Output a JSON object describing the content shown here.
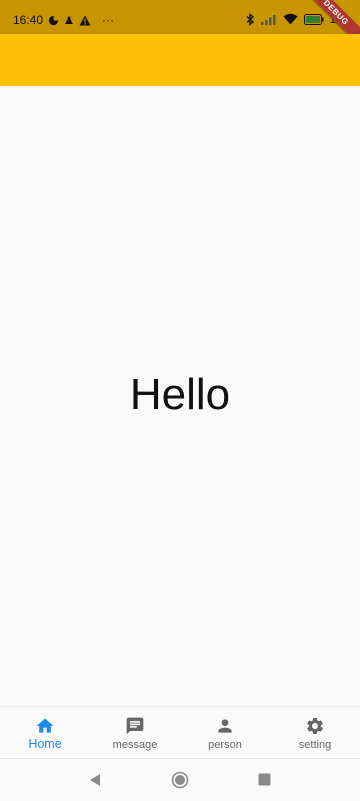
{
  "status_bar": {
    "time": "16:40",
    "overflow": "···",
    "battery": "11",
    "icons": [
      "vpn-icon",
      "usb-icon",
      "warning-icon",
      "bluetooth-icon",
      "signal-icon",
      "wifi-icon",
      "battery-icon"
    ],
    "background": "#c89400"
  },
  "debug_banner": "DEBUG",
  "app_bar": {
    "color": "#ffc107"
  },
  "main": {
    "text": "Hello"
  },
  "bottom_nav": {
    "active_color": "#1e88e5",
    "inactive_color": "#666666",
    "items": [
      {
        "label": "Home",
        "icon": "home-icon",
        "active": true
      },
      {
        "label": "message",
        "icon": "message-icon",
        "active": false
      },
      {
        "label": "person",
        "icon": "person-icon",
        "active": false
      },
      {
        "label": "setting",
        "icon": "gear-icon",
        "active": false
      }
    ]
  },
  "system_nav": {
    "buttons": [
      "back-icon",
      "home-circle-icon",
      "recents-icon"
    ]
  }
}
